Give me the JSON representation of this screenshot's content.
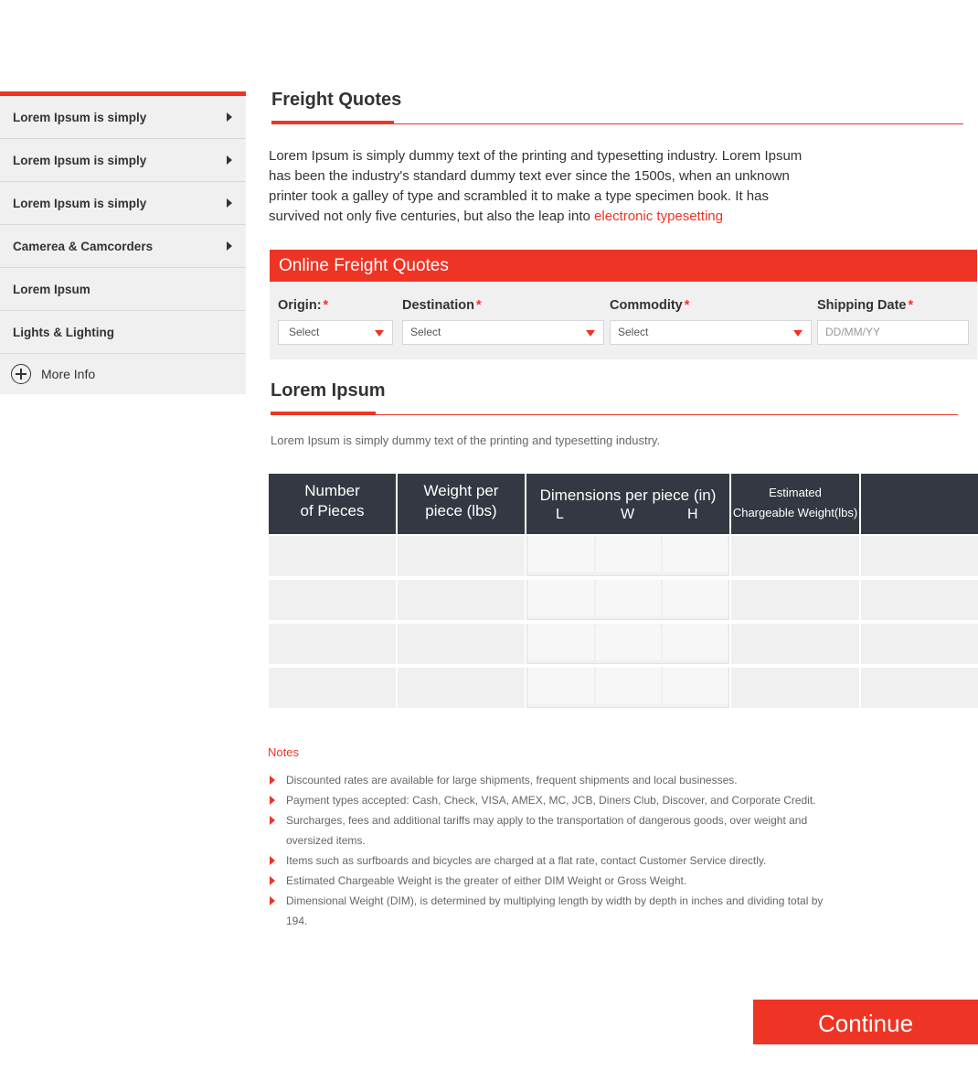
{
  "sidebar": {
    "items": [
      {
        "label": "Lorem Ipsum is simply"
      },
      {
        "label": "Lorem Ipsum is simply"
      },
      {
        "label": "Lorem Ipsum is simply"
      },
      {
        "label": "Camerea & Camcorders"
      },
      {
        "label": "Lorem Ipsum"
      },
      {
        "label": "Lights & Lighting"
      }
    ],
    "more_label": "More Info"
  },
  "page": {
    "title": "Freight Quotes",
    "intro": "Lorem Ipsum is simply dummy text of the printing and typesetting industry. Lorem Ipsum has been the industry's standard dummy text ever since the 1500s, when an unknown printer took a galley of type and scrambled it to make a type specimen book. It has survived not only five centuries, but also the leap into ",
    "intro_link": "electronic typesetting"
  },
  "quote_form": {
    "header": "Online Freight Quotes",
    "fields": [
      {
        "label": "Origin:",
        "required_mark": "*",
        "value": "Select"
      },
      {
        "label": "Destination",
        "required_mark": "*",
        "value": "Select"
      },
      {
        "label": "Commodity",
        "required_mark": "*",
        "value": "Select"
      },
      {
        "label": "Shipping Date",
        "required_mark": "*",
        "placeholder": "DD/MM/YY"
      }
    ]
  },
  "section2": {
    "title": "Lorem Ipsum",
    "text": "Lorem Ipsum is simply dummy text of the printing and typesetting industry."
  },
  "table": {
    "headers": {
      "pieces_line1": "Number",
      "pieces_line2": "of Pieces",
      "weight_line1": "Weight per",
      "weight_line2": "piece (lbs)",
      "dimensions": "Dimensions per piece (in)",
      "dim_l": "L",
      "dim_w": "W",
      "dim_h": "H",
      "est_line1": "Estimated",
      "est_line2": "Chargeable Weight(lbs)",
      "extra": ""
    }
  },
  "notes": {
    "title": "Notes",
    "items": [
      "Discounted rates are available for large shipments, frequent shipments and local businesses.",
      "Payment types accepted: Cash, Check, VISA, AMEX, MC, JCB, Diners Club, Discover, and Corporate Credit.",
      "Surcharges, fees and additional tariffs may apply to the transportation of dangerous goods, over weight and oversized items.",
      "Items such as surfboards and bicycles are charged at a flat rate, contact Customer Service directly.",
      "Estimated Chargeable Weight is the greater of either DIM Weight or Gross Weight.",
      "Dimensional Weight (DIM), is determined by multiplying length by width by depth in inches and dividing total by 194."
    ]
  },
  "continue_label": "Continue",
  "colors": {
    "accent": "#ee3424",
    "table_header": "#333842"
  }
}
